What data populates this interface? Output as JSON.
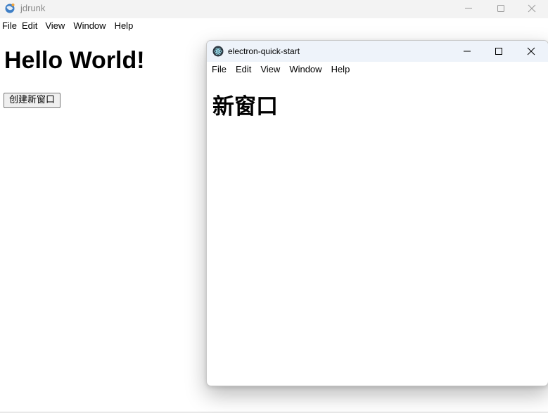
{
  "main_window": {
    "title": "jdrunk",
    "app_icon": "electron-app-icon",
    "controls": [
      "minimize-icon",
      "maximize-icon",
      "close-icon"
    ],
    "menu": [
      "File",
      "Edit",
      "View",
      "Window",
      "Help"
    ],
    "heading": "Hello World!",
    "button_label": "创建新窗口"
  },
  "child_window": {
    "title": "electron-quick-start",
    "app_icon": "electron-icon",
    "controls": [
      "minimize-icon",
      "maximize-icon",
      "close-icon"
    ],
    "menu": [
      "File",
      "Edit",
      "View",
      "Window",
      "Help"
    ],
    "heading": "新窗口"
  },
  "colors": {
    "main_titlebar": "#f3f3f3",
    "child_titlebar": "#eef3fa",
    "button_bg": "#efefef",
    "button_border": "#767676"
  }
}
